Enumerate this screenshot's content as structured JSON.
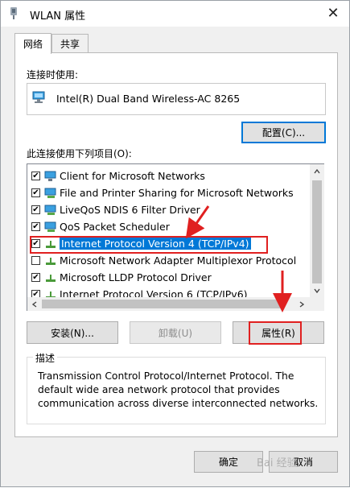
{
  "window": {
    "title": "WLAN 属性",
    "close_glyph": "✕"
  },
  "tabs": [
    {
      "label": "网络"
    },
    {
      "label": "共享"
    }
  ],
  "connect_using_label": "连接时使用:",
  "adapter_name": "Intel(R) Dual Band Wireless-AC 8265",
  "configure_button": "配置(C)...",
  "items_label": "此连接使用下列项目(O):",
  "items": [
    {
      "label": "Client for Microsoft Networks",
      "checked": true,
      "icon": "network-client-icon"
    },
    {
      "label": "File and Printer Sharing for Microsoft Networks",
      "checked": true,
      "icon": "network-service-icon"
    },
    {
      "label": "LiveQoS NDIS 6 Filter Driver",
      "checked": true,
      "icon": "network-service-icon"
    },
    {
      "label": "QoS Packet Scheduler",
      "checked": true,
      "icon": "network-service-icon"
    },
    {
      "label": "Internet Protocol Version 4 (TCP/IPv4)",
      "checked": true,
      "icon": "protocol-icon",
      "selected": true
    },
    {
      "label": "Microsoft Network Adapter Multiplexor Protocol",
      "checked": false,
      "icon": "protocol-icon"
    },
    {
      "label": "Microsoft LLDP Protocol Driver",
      "checked": true,
      "icon": "protocol-icon"
    },
    {
      "label": "Internet Protocol Version 6 (TCP/IPv6)",
      "checked": true,
      "icon": "protocol-icon"
    }
  ],
  "buttons": {
    "install": "安装(N)...",
    "uninstall": "卸载(U)",
    "properties": "属性(R)",
    "ok": "确定",
    "cancel": "取消"
  },
  "description": {
    "title": "描述",
    "text": "Transmission Control Protocol/Internet Protocol. The default wide area network protocol that provides communication across diverse interconnected networks."
  },
  "colors": {
    "selection": "#0078d7",
    "annotation": "#e02020"
  },
  "watermark": "Bai 经验"
}
